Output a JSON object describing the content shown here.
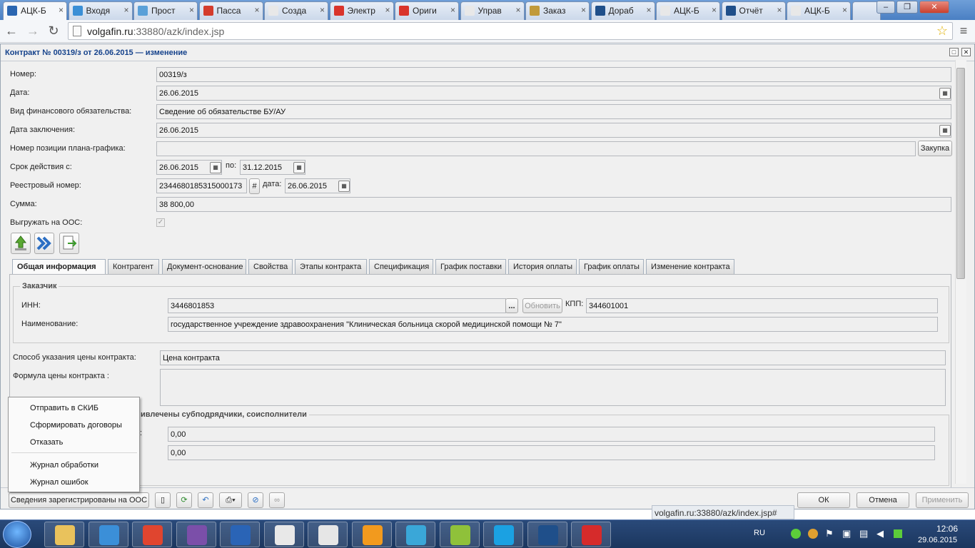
{
  "browser": {
    "tabs": [
      {
        "label": "АЦК-Б",
        "color": "#2b66b1",
        "active": true
      },
      {
        "label": "Входя",
        "color": "#3a8fd6"
      },
      {
        "label": "Прост",
        "color": "#5aa0d8"
      },
      {
        "label": "Пасса",
        "color": "#d43c2c"
      },
      {
        "label": "Созда",
        "color": "#e8e8e8"
      },
      {
        "label": "Электр",
        "color": "#d9342b"
      },
      {
        "label": "Ориги",
        "color": "#d9342b"
      },
      {
        "label": "Управ",
        "color": "#e8e8e8"
      },
      {
        "label": "Заказ",
        "color": "#c19a3a"
      },
      {
        "label": "Дораб",
        "color": "#1f4f8a"
      },
      {
        "label": "АЦК-Б",
        "color": "#e8e8e8"
      },
      {
        "label": "Отчёт",
        "color": "#1f4f8a"
      },
      {
        "label": "АЦК-Б",
        "color": "#e8e8e8"
      }
    ],
    "url_host": "volgafin.ru",
    "url_rest": ":33880/azk/index.jsp",
    "status_url": "volgafin.ru:33880/azk/index.jsp#"
  },
  "dialog": {
    "title": "Контракт № 00319/з от 26.06.2015 — изменение",
    "fields": {
      "number_label": "Номер:",
      "number_value": "00319/з",
      "date_label": "Дата:",
      "date_value": "26.06.2015",
      "obligation_label": "Вид финансового обязательства:",
      "obligation_value": "Сведение об обязательстве БУ/АУ",
      "conclusion_label": "Дата заключения:",
      "conclusion_value": "26.06.2015",
      "plan_label": "Номер позиции плана-графика:",
      "plan_value": "",
      "plan_button": "Закупка",
      "term_label": "Срок действия с:",
      "term_from": "26.06.2015",
      "term_to_label": "по:",
      "term_to": "31.12.2015",
      "registry_label": "Реестровый номер:",
      "registry_value": "2344680185315000173",
      "registry_hash": "#",
      "registry_date_label": "дата:",
      "registry_date": "26.06.2015",
      "sum_label": "Сумма:",
      "sum_value": "38 800,00",
      "oos_label": "Выгружать на ООС:",
      "oos_check": "✓"
    },
    "tabs": [
      "Общая информация",
      "Контрагент",
      "Документ-основание",
      "Свойства",
      "Этапы контракта",
      "Спецификация",
      "График поставки",
      "История оплаты",
      "График оплаты",
      "Изменение контракта"
    ],
    "customer": {
      "legend": "Заказчик",
      "inn_label": "ИНН:",
      "inn_value": "3446801853",
      "dots": "...",
      "refresh_button": "Обновить",
      "kpp_label": "КПП:",
      "kpp_value": "344601001",
      "name_label": "Наименование:",
      "name_value": "государственное учреждение здравоохранения \"Клиническая больница скорой медицинской помощи № 7\""
    },
    "price": {
      "method_label": "Способ указания цены контракта:",
      "method_value": "Цена контракта",
      "formula_label": "Формула цены контракта :",
      "formula_value": ""
    },
    "subcontract": {
      "legend_fragment": "ивлечены субподрядчики, соисполнители",
      "colon": ":",
      "value1": "0,00",
      "value2": "0,00"
    },
    "context_menu": [
      "Отправить в СКИБ",
      "Сформировать договоры",
      "Отказать",
      "Журнал обработки",
      "Журнал ошибок"
    ],
    "footer": {
      "state_button": "Сведения зарегистрированы на ООС",
      "ok": "ОК",
      "cancel": "Отмена",
      "apply": "Применить"
    }
  },
  "taskbar": {
    "apps": [
      "#e9c25c",
      "#3b8fd8",
      "#e0452f",
      "#7b4fa9",
      "#2a64b6",
      "#e8e8e8",
      "#e6e6e6",
      "#f29a1e",
      "#3aa7d8",
      "#8fc13a",
      "#1ba1e2",
      "#1f4f8a",
      "#d62b2b"
    ],
    "lang": "RU",
    "time": "12:06",
    "date": "29.06.2015"
  }
}
